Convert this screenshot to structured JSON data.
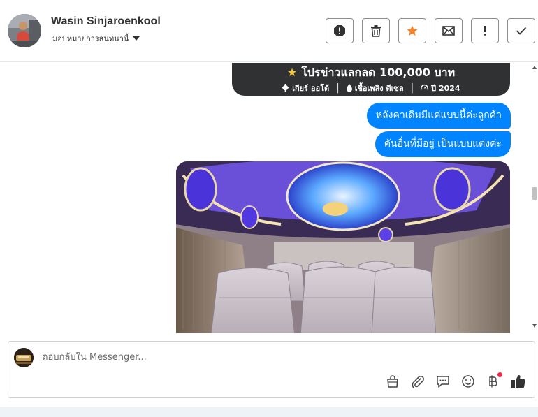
{
  "header": {
    "user_name": "Wasin Sinjaroenkool",
    "assign_label": "มอบหมายการสนทนานี้",
    "actions": [
      "report-icon",
      "trash-icon",
      "star-icon",
      "mail-icon",
      "exclamation-icon",
      "check-icon"
    ],
    "star_color": "#f5822a"
  },
  "card": {
    "title": "โปรข่าวแลกลด 100,000 บาท",
    "gear": "เกียร์ ออโต้",
    "fuel": "เชื้อเพลิง ดีเซล",
    "year": "ปี 2024"
  },
  "messages": [
    "หลังคาเดิมมีแค่แบบนี้ค่ะลูกค้า",
    "คันอื่นที่มีอยู่ เป็นแบบแต่งค่ะ"
  ],
  "composer": {
    "placeholder": "ตอบกลับใน Messenger...",
    "tools": [
      "bag-icon",
      "paperclip-icon",
      "saved-reply-icon",
      "emoji-icon",
      "baht-icon",
      "thumbs-up-icon"
    ]
  },
  "colors": {
    "bubble": "#0084ff",
    "card_bg": "#2f3133",
    "notification_dot": "#f02849"
  }
}
